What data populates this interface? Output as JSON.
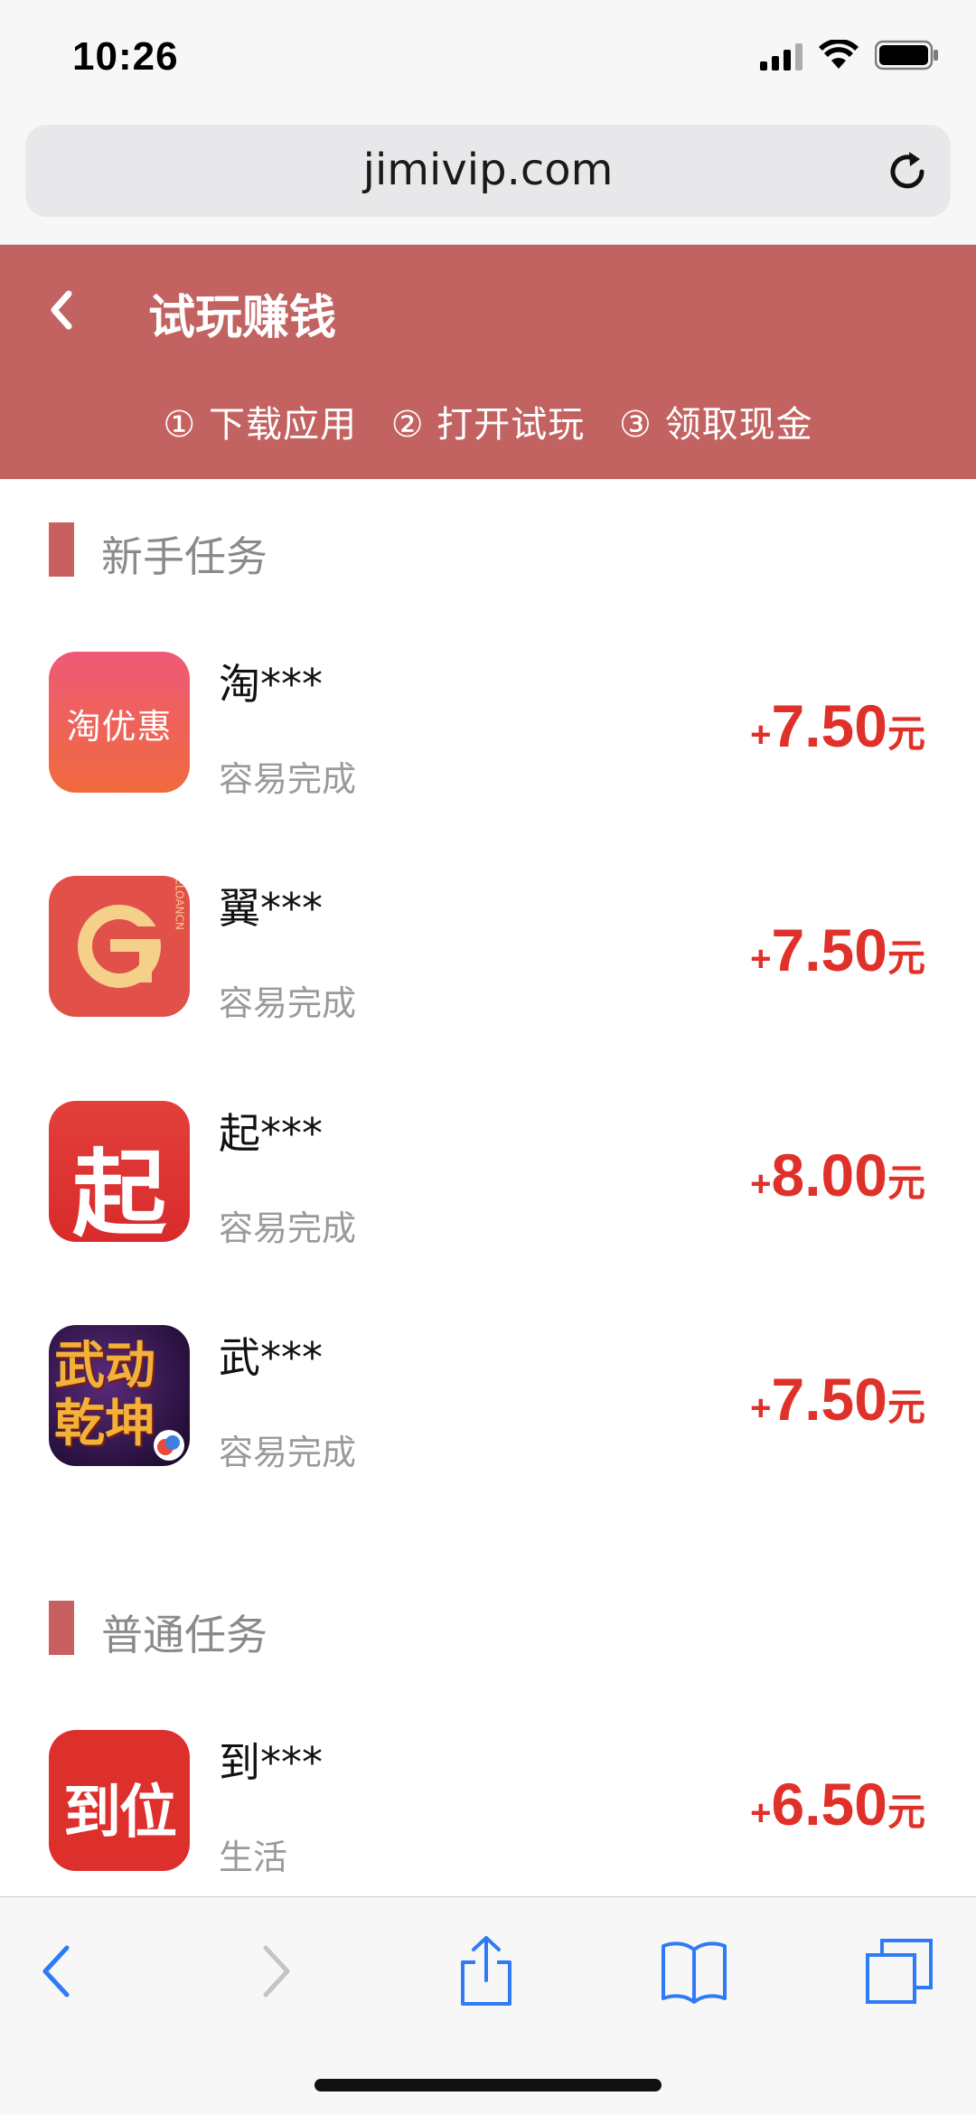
{
  "status_bar": {
    "time": "10:26",
    "icons": [
      "signal-icon",
      "wifi-icon",
      "battery-icon"
    ]
  },
  "browser": {
    "url": "jimivip.com",
    "reload_icon": "reload-icon"
  },
  "header": {
    "title": "试玩赚钱",
    "back_icon": "chevron-left-icon",
    "steps": [
      "① 下载应用",
      "② 打开试玩",
      "③ 领取现金"
    ]
  },
  "sections": {
    "newbie": {
      "label": "新手任务",
      "tasks": [
        {
          "name": "淘***",
          "sub": "容易完成",
          "plus": "+",
          "amount": "7.50",
          "unit": "元",
          "icon_text": "淘优惠"
        },
        {
          "name": "翼***",
          "sub": "容易完成",
          "plus": "+",
          "amount": "7.50",
          "unit": "元",
          "icon_text": "ELOANCN"
        },
        {
          "name": "起***",
          "sub": "容易完成",
          "plus": "+",
          "amount": "8.00",
          "unit": "元",
          "icon_text": "起"
        },
        {
          "name": "武***",
          "sub": "容易完成",
          "plus": "+",
          "amount": "7.50",
          "unit": "元",
          "icon_text": "武动乾坤"
        }
      ]
    },
    "normal": {
      "label": "普通任务",
      "tasks": [
        {
          "name": "到***",
          "sub": "生活",
          "plus": "+",
          "amount": "6.50",
          "unit": "元",
          "icon_text": "到位"
        }
      ]
    }
  },
  "toolbar": {
    "icons": [
      "back-arrow-icon",
      "forward-arrow-icon",
      "share-icon",
      "bookmarks-icon",
      "tabs-icon"
    ]
  },
  "colors": {
    "header": "#c26361",
    "reward": "#e0302a",
    "accent_bar": "#c8605f"
  }
}
